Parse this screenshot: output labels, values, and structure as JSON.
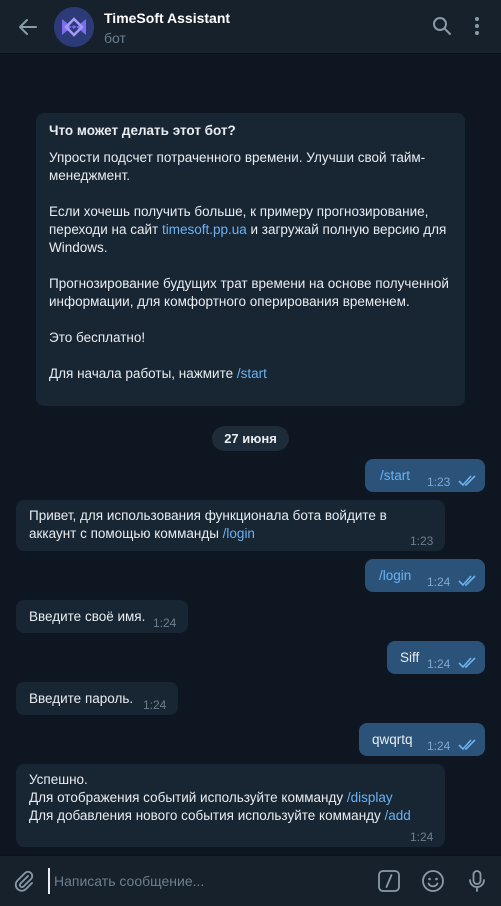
{
  "header": {
    "title": "TimeSoft Assistant",
    "subtitle": "бот"
  },
  "bot_info": {
    "heading": "Что может делать этот бот?",
    "p1": "Упрости подсчет потраченного времени. Улучши свой тайм-менеджмент.",
    "p2_before": "Если хочешь получить больше, к примеру прогнозирование, переходи на сайт ",
    "p2_link": "timesoft.pp.ua",
    "p2_after": " и загружай полную версию для Windows.",
    "p3": "Прогнозирование будущих трат времени на основе полученной информации, для  комфортного оперирования временем.",
    "p4": "Это бесплатно!",
    "p5_before": "Для начала работы, нажмите ",
    "p5_link": "/start"
  },
  "date_separator": "27 июня",
  "messages": [
    {
      "dir": "out",
      "text": "/start",
      "time": "1:23"
    },
    {
      "dir": "in",
      "text1": "Привет, для использования функционала бота войдите в аккаунт с помощью комманды ",
      "link": "/login",
      "time": "1:23"
    },
    {
      "dir": "out",
      "text": "/login",
      "time": "1:24"
    },
    {
      "dir": "in",
      "text": "Введите своё имя.",
      "time": "1:24"
    },
    {
      "dir": "out",
      "text": "Siff",
      "time": "1:24"
    },
    {
      "dir": "in",
      "text": "Введите пароль.",
      "time": "1:24"
    },
    {
      "dir": "out",
      "text": "qwqrtq",
      "time": "1:24"
    },
    {
      "dir": "in",
      "line1": "Успешно.",
      "line2_before": "Для отображения событий используйте комманду ",
      "line2_link": "/display",
      "line3_before": "Для добавления нового события используйте комманду ",
      "line3_link": "/add",
      "time": "1:24"
    }
  ],
  "composer": {
    "placeholder": "Написать сообщение..."
  },
  "colors": {
    "background": "#0e1621",
    "header": "#17212b",
    "incoming_bubble": "#182533",
    "outgoing_bubble": "#2b5278",
    "link": "#6ab3f3"
  },
  "icons": [
    "back-arrow-icon",
    "bot-logo-icon",
    "search-icon",
    "more-vertical-icon",
    "double-check-icon",
    "paperclip-icon",
    "slash-command-icon",
    "emoji-icon",
    "microphone-icon"
  ]
}
